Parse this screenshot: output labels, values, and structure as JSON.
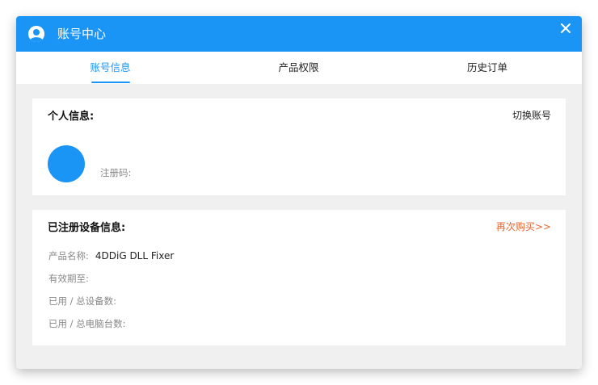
{
  "window": {
    "title": "账号中心",
    "close_symbol": "✕"
  },
  "tabs": [
    {
      "label": "账号信息",
      "active": true
    },
    {
      "label": "产品权限",
      "active": false
    },
    {
      "label": "历史订单",
      "active": false
    }
  ],
  "personal": {
    "title": "个人信息:",
    "switch_label": "切换账号",
    "reg_code_label": "注册码:"
  },
  "device": {
    "title": "已注册设备信息:",
    "buy_label": "再次购买>>",
    "rows": [
      {
        "label": "产品名称:",
        "value": "4DDiG DLL Fixer"
      },
      {
        "label": "有效期至:",
        "value": ""
      },
      {
        "label": "已用 / 总设备数:",
        "value": ""
      },
      {
        "label": "已用 / 总电脑台数:",
        "value": ""
      }
    ]
  },
  "colors": {
    "accent": "#1b95f5",
    "buy_link": "#e8662e",
    "background": "#f0f0f0"
  },
  "icons": {
    "titlebar": "user-avatar-icon",
    "close": "close-icon"
  }
}
